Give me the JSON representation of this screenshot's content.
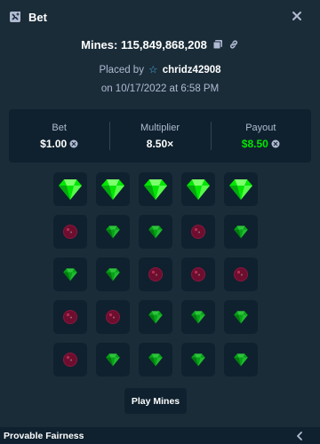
{
  "header": {
    "title": "Bet",
    "icon": "bet-slip-icon"
  },
  "bet": {
    "title": "Mines: 115,849,868,208",
    "placed_prefix": "Placed by",
    "username": "chridz42908",
    "date": "on 10/17/2022 at 6:58 PM"
  },
  "stats": {
    "bet_label": "Bet",
    "bet_value": "$1.00",
    "multiplier_label": "Multiplier",
    "multiplier_value": "8.50×",
    "payout_label": "Payout",
    "payout_value": "$8.50"
  },
  "grid": [
    [
      "gem-picked",
      "gem-picked",
      "gem-picked",
      "gem-picked",
      "gem-picked"
    ],
    [
      "mine",
      "gem",
      "gem",
      "mine",
      "gem"
    ],
    [
      "gem",
      "gem",
      "mine",
      "mine",
      "mine"
    ],
    [
      "mine",
      "mine",
      "gem",
      "gem",
      "gem"
    ],
    [
      "mine",
      "gem",
      "gem",
      "gem",
      "gem"
    ]
  ],
  "play_button": "Play Mines",
  "footer": {
    "label": "Provable Fairness"
  },
  "colors": {
    "background": "#1a2c38",
    "panel": "#0f212e",
    "accent_green": "#00e701"
  }
}
